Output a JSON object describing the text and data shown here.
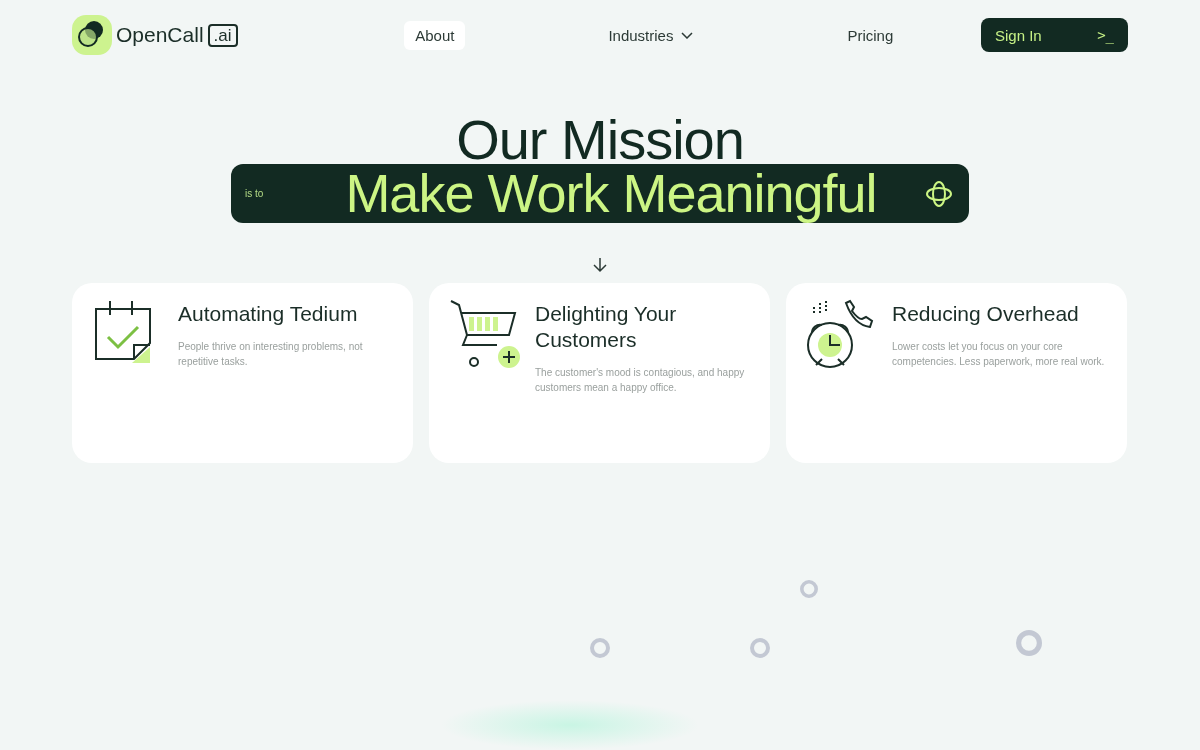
{
  "logo": {
    "name": "OpenCall",
    "suffix": ".ai"
  },
  "nav": [
    {
      "label": "About",
      "selected": true,
      "dropdown": false
    },
    {
      "label": "Industries",
      "selected": false,
      "dropdown": true
    },
    {
      "label": "Pricing",
      "selected": false,
      "dropdown": false
    }
  ],
  "sign_in": {
    "label": "Sign In",
    "icon": ">_"
  },
  "hero": {
    "title": "Our Mission",
    "prefix": "is to",
    "tagline": "Make Work Meaningful"
  },
  "cards": [
    {
      "kind": "calendar",
      "title": "Automating Tedium",
      "text": "People thrive on interesting problems, not repetitive tasks."
    },
    {
      "kind": "cart",
      "title": "Delighting Your Customers",
      "text": "The customer's mood is contagious, and happy customers mean a happy office."
    },
    {
      "kind": "clock",
      "title": "Reducing Overhead",
      "text": "Lower costs let you focus on your core competencies. Less paperwork, more real work."
    }
  ]
}
